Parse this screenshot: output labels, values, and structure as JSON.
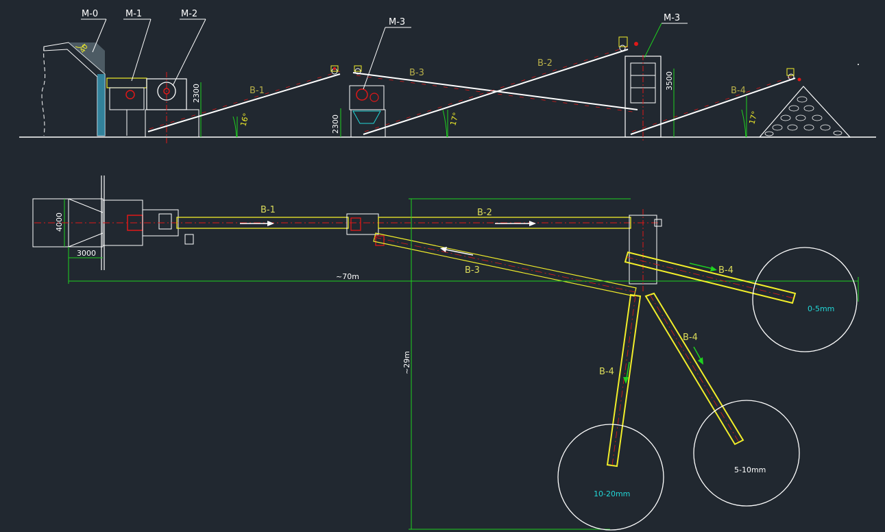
{
  "colors": {
    "background": "#212830",
    "white": "#ffffff",
    "yellow": "#f2ee2a",
    "green": "#1fd21f",
    "red": "#e01818",
    "cyan": "#22d8d8",
    "olive": "#b8b04a",
    "label": "#dcdc5a"
  },
  "labels": {
    "m0": "M-0",
    "m1": "M-1",
    "m2": "M-2",
    "m3_left": "M-3",
    "m3_right": "M-3",
    "b1_elev": "B-1",
    "b2_elev": "B-2",
    "b3_elev": "B-3",
    "b4_elev": "B-4",
    "b1_plan": "B-1",
    "b2_plan": "B-2",
    "b3_plan": "B-3",
    "b4_plan_a": "B-4",
    "b4_plan_b": "B-4",
    "b4_plan_c": "B-4"
  },
  "dimensions": {
    "hopper_angle": "40",
    "dim_2300_a": "2300",
    "dim_2300_b": "2300",
    "dim_3500": "3500",
    "angle_16": "16°",
    "angle_17_a": "17°",
    "angle_17_b": "17°",
    "dim_4000": "4000",
    "dim_3000": "3000",
    "dim_70m": "~70m",
    "dim_29m": "~29m"
  },
  "piles": {
    "p1": "0-5mm",
    "p2": "5-10mm",
    "p3": "10-20mm"
  }
}
